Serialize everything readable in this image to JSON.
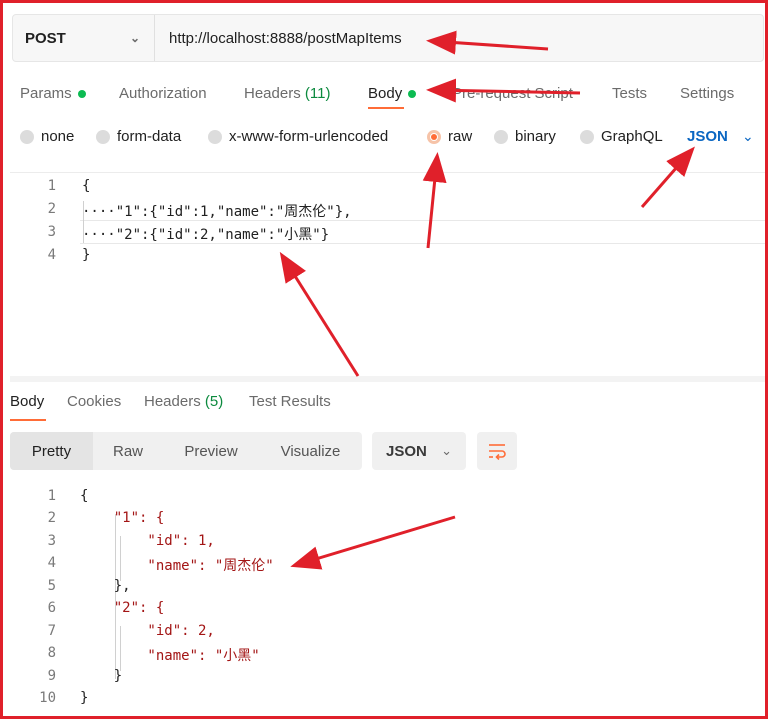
{
  "request": {
    "method": "POST",
    "url": "http://localhost:8888/postMapItems"
  },
  "request_tabs": [
    {
      "label": "Params",
      "dot": true
    },
    {
      "label": "Authorization"
    },
    {
      "label": "Headers",
      "count": "(11)"
    },
    {
      "label": "Body",
      "dot": true,
      "active": true
    },
    {
      "label": "Pre-request Script"
    },
    {
      "label": "Tests"
    },
    {
      "label": "Settings"
    }
  ],
  "body_types": {
    "options": [
      "none",
      "form-data",
      "x-www-form-urlencoded",
      "raw",
      "binary",
      "GraphQL"
    ],
    "selected": "raw",
    "format": "JSON"
  },
  "request_body": {
    "line_numbers": [
      "1",
      "2",
      "3",
      "4"
    ],
    "lines": [
      "{",
      "····\"1\":{\"id\":1,\"name\":\"周杰伦\"},",
      "····\"2\":{\"id\":2,\"name\":\"小黑\"}",
      "}"
    ]
  },
  "response_tabs": [
    {
      "label": "Body",
      "active": true
    },
    {
      "label": "Cookies"
    },
    {
      "label": "Headers",
      "count": "(5)"
    },
    {
      "label": "Test Results"
    }
  ],
  "response_view": {
    "modes": [
      "Pretty",
      "Raw",
      "Preview",
      "Visualize"
    ],
    "selected": "Pretty",
    "format": "JSON"
  },
  "response_body": {
    "line_numbers": [
      "1",
      "2",
      "3",
      "4",
      "5",
      "6",
      "7",
      "8",
      "9",
      "10"
    ],
    "lines": [
      "{",
      "    \"1\": {",
      "        \"id\": 1,",
      "        \"name\": \"周杰伦\"",
      "    },",
      "    \"2\": {",
      "        \"id\": 2,",
      "        \"name\": \"小黑\"",
      "    }",
      "}"
    ]
  },
  "colors": {
    "annotation_red": "#e0202a",
    "accent_orange": "#ff6c37",
    "status_green": "#0cbb52",
    "link_blue": "#0a66c2"
  }
}
